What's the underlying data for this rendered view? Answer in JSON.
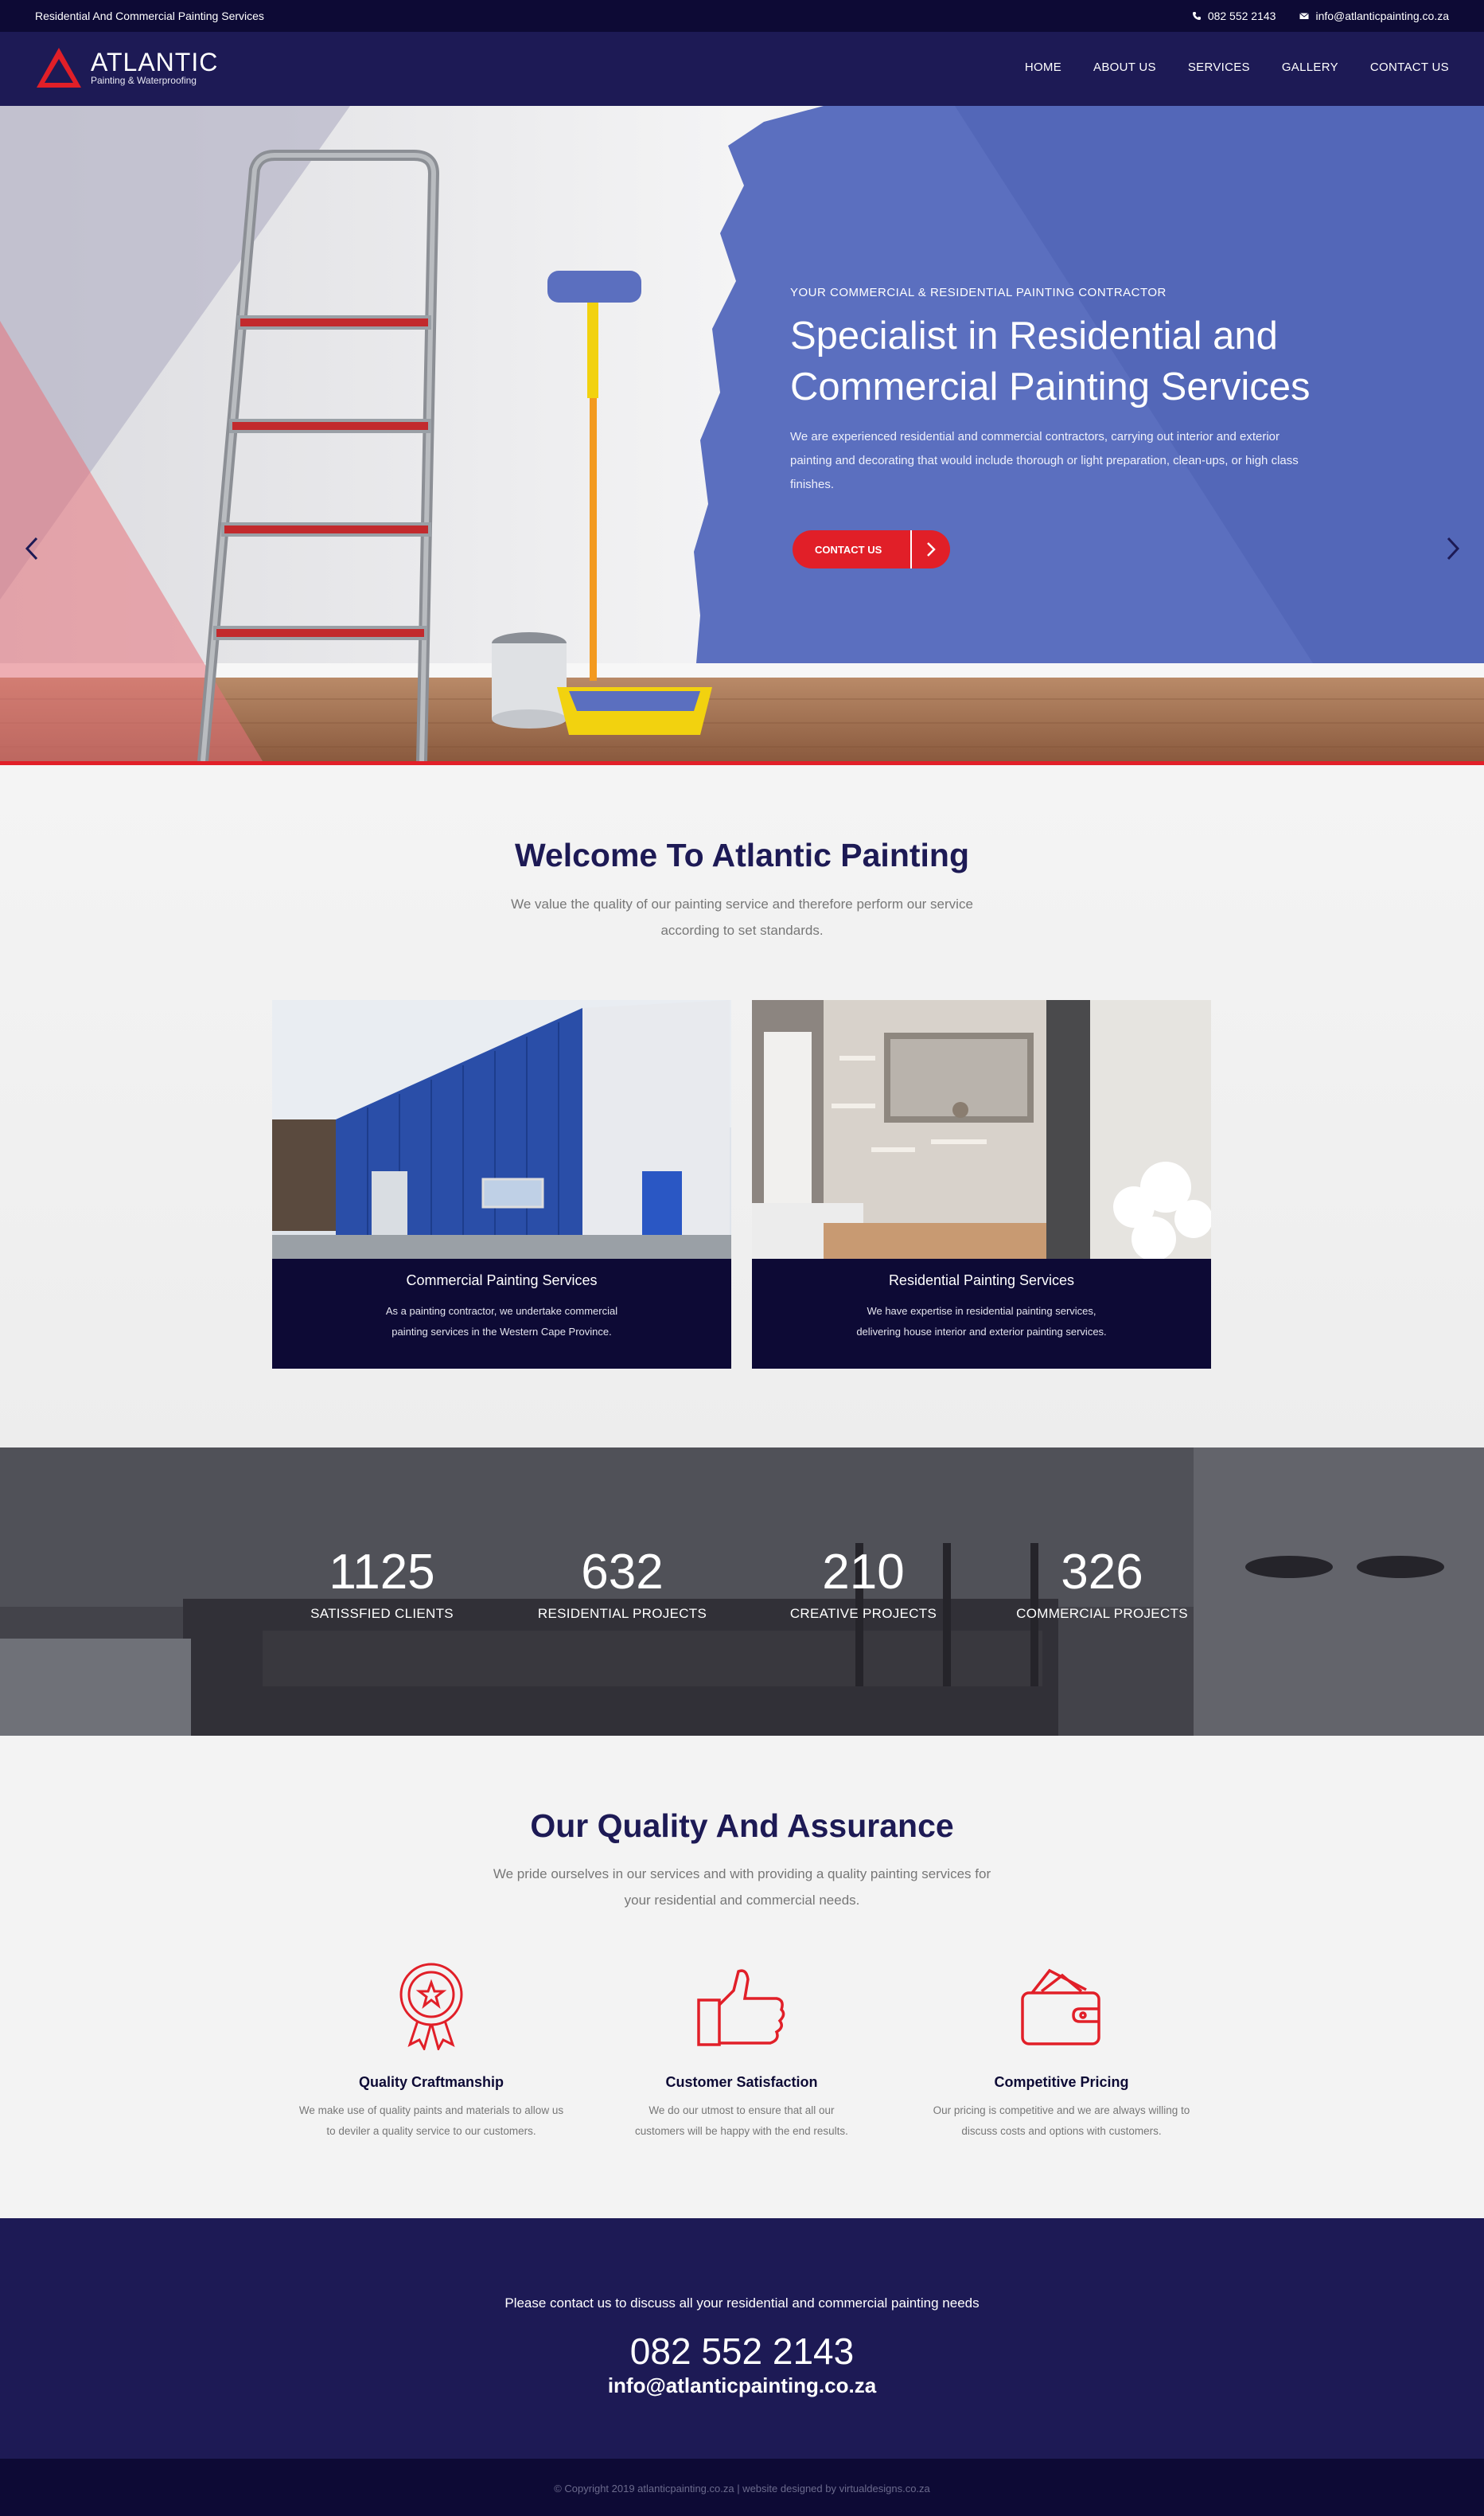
{
  "topbar": {
    "tagline": "Residential And Commercial Painting Services",
    "phone": "082 552 2143",
    "email": "info@atlanticpainting.co.za"
  },
  "header": {
    "logo_name": "ATLANTIC",
    "logo_sub": "Painting & Waterproofing",
    "nav": [
      "HOME",
      "ABOUT US",
      "SERVICES",
      "GALLERY",
      "CONTACT US"
    ]
  },
  "hero": {
    "kicker": "YOUR COMMERCIAL & RESIDENTIAL PAINTING CONTRACTOR",
    "title_line1": "Specialist in Residential and",
    "title_line2": "Commercial Painting Services",
    "description": "We are experienced residential and commercial contractors, carrying out interior and exterior painting and decorating that would include thorough or light preparation, clean-ups, or high class finishes.",
    "button_label": "CONTACT US"
  },
  "welcome": {
    "title": "Welcome To Atlantic Painting",
    "subtitle_line1": "We value the quality of our painting service and therefore perform our service",
    "subtitle_line2": "according to set standards.",
    "cards": [
      {
        "title": "Commercial Painting Services",
        "desc_line1": "As a painting contractor, we undertake commercial",
        "desc_line2": "painting services in the Western Cape Province."
      },
      {
        "title": "Residential Painting Services",
        "desc_line1": "We have expertise in residential painting services,",
        "desc_line2": "delivering house interior and exterior painting services."
      }
    ]
  },
  "stats": [
    {
      "value": "1125",
      "label": "SATISSFIED CLIENTS"
    },
    {
      "value": "632",
      "label": "RESIDENTIAL PROJECTS"
    },
    {
      "value": "210",
      "label": "CREATIVE PROJECTS"
    },
    {
      "value": "326",
      "label": "COMMERCIAL PROJECTS"
    }
  ],
  "quality": {
    "title": "Our Quality And Assurance",
    "subtitle_line1": "We pride ourselves in our services and with providing a quality painting services for",
    "subtitle_line2": "your residential and commercial needs.",
    "features": [
      {
        "icon": "award-ribbon-icon",
        "title": "Quality Craftmanship",
        "desc_line1": "We make use of quality paints and materials to allow us",
        "desc_line2": "to deviler a quality service to our customers."
      },
      {
        "icon": "thumbs-up-icon",
        "title": "Customer Satisfaction",
        "desc_line1": "We do our utmost to ensure that all our",
        "desc_line2": "customers will be happy with the end results."
      },
      {
        "icon": "wallet-money-icon",
        "title": "Competitive Pricing",
        "desc_line1": "Our pricing is competitive and we are always willing to",
        "desc_line2": "discuss costs and options with customers."
      }
    ]
  },
  "cta": {
    "text": "Please contact us to discuss all your residential and commercial painting needs",
    "phone": "082 552 2143",
    "email": "info@atlanticpainting.co.za"
  },
  "footer": {
    "copyright": "© Copyright 2019 atlanticpainting.co.za | website designed by virtualdesigns.co.za"
  },
  "colors": {
    "navy_dark": "#0d0a35",
    "navy": "#1d1a55",
    "accent_red": "#e11f28",
    "hero_blue": "#5b6fbf"
  }
}
